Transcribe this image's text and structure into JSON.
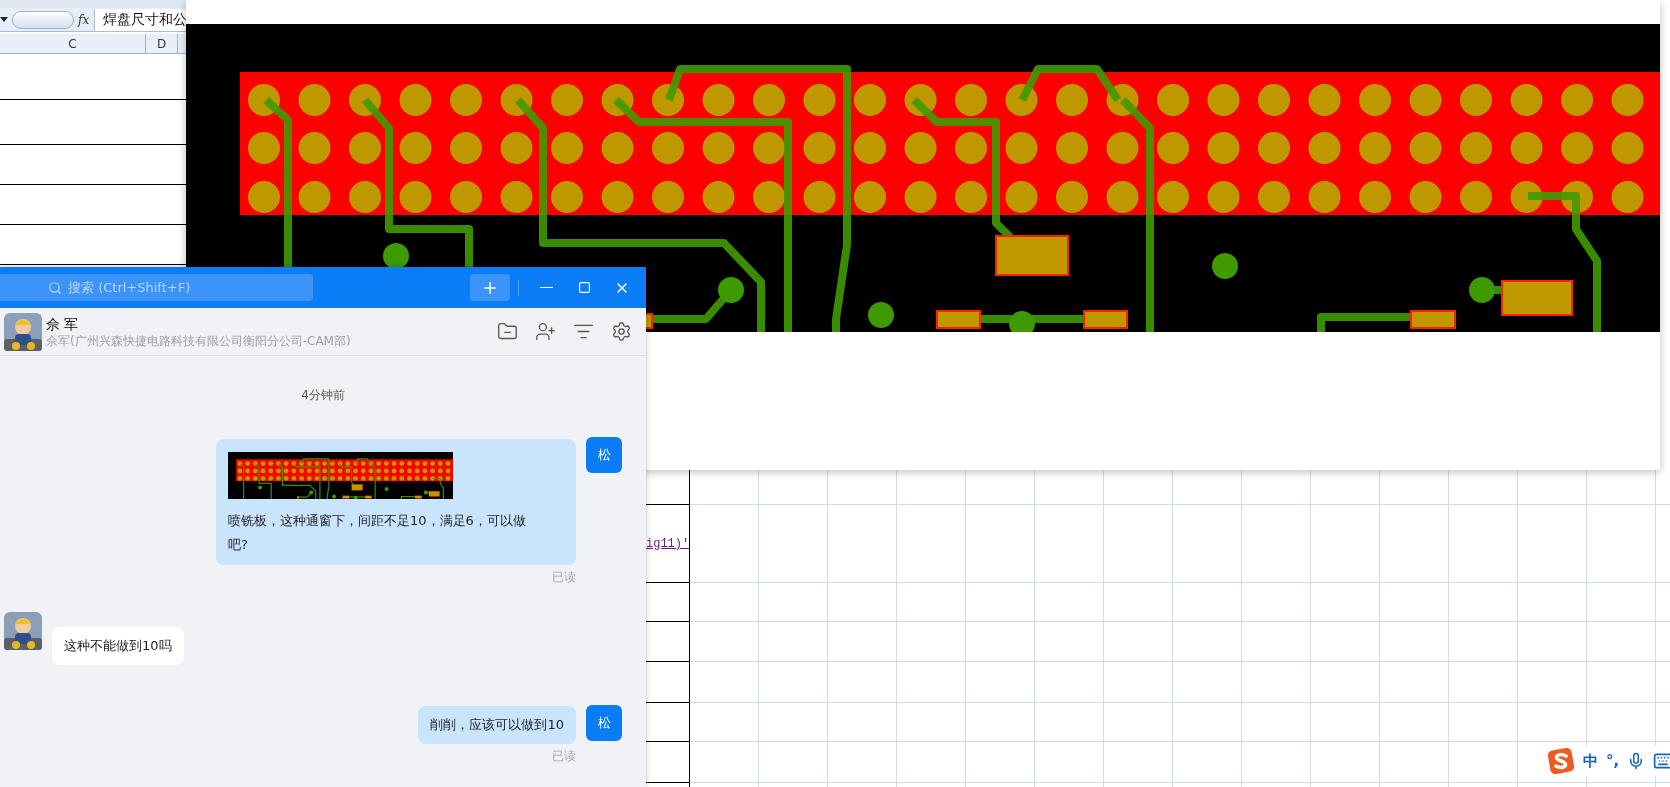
{
  "spreadsheet": {
    "function_label": "fx",
    "formula_text": "焊盘尺寸和公",
    "columns": [
      "C",
      "D"
    ],
    "link_cells": [
      "ig11)'"
    ]
  },
  "chat": {
    "search": {
      "placeholder": "搜索 (Ctrl+Shift+F)"
    },
    "contact": {
      "name": "佘 军",
      "subtitle": "佘军(广州兴森快捷电路科技有限公司衡阳分公司-CAM部)"
    },
    "timestamp": "4分钟前",
    "messages": [
      {
        "kind": "sent",
        "avatar": "松",
        "image": true,
        "text": "喷铣板，这种通窗下，间距不足10，满足6，可以做吧?",
        "status": "已读"
      },
      {
        "kind": "received",
        "image": false,
        "text": "这种不能做到10吗"
      },
      {
        "kind": "sent",
        "avatar": "松",
        "image": false,
        "text": "削削，应该可以做到10",
        "status": "已读"
      }
    ]
  },
  "ime": {
    "mode": "中",
    "punctuation": "°,"
  }
}
